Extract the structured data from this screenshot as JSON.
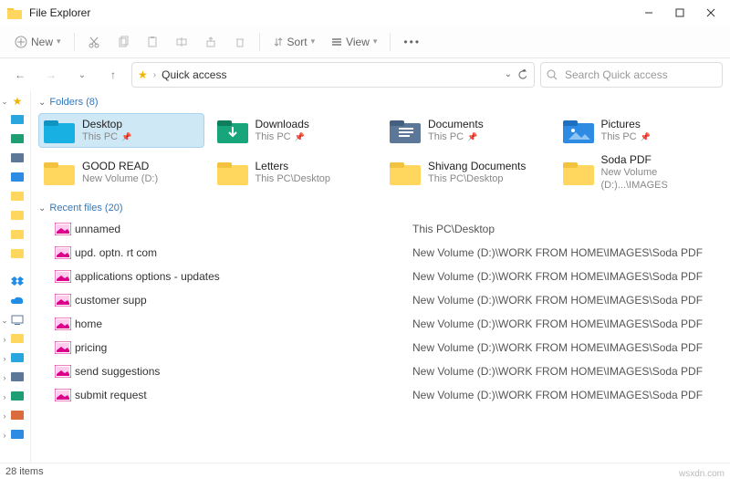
{
  "window": {
    "title": "File Explorer"
  },
  "toolbar": {
    "new": "New",
    "sort": "Sort",
    "view": "View"
  },
  "address": {
    "crumb": "Quick access"
  },
  "search": {
    "placeholder": "Search Quick access"
  },
  "groups": {
    "folders_label": "Folders (8)",
    "recent_label": "Recent files (20)"
  },
  "folders": [
    {
      "name": "Desktop",
      "sub": "This PC",
      "pinned": true,
      "icon": "desktop",
      "selected": true
    },
    {
      "name": "Downloads",
      "sub": "This PC",
      "pinned": true,
      "icon": "download",
      "selected": false
    },
    {
      "name": "Documents",
      "sub": "This PC",
      "pinned": true,
      "icon": "document",
      "selected": false
    },
    {
      "name": "Pictures",
      "sub": "This PC",
      "pinned": true,
      "icon": "picture",
      "selected": false
    },
    {
      "name": "GOOD READ",
      "sub": "New Volume (D:)",
      "pinned": false,
      "icon": "folder",
      "selected": false
    },
    {
      "name": "Letters",
      "sub": "This PC\\Desktop",
      "pinned": false,
      "icon": "folder",
      "selected": false
    },
    {
      "name": "Shivang Documents",
      "sub": "This PC\\Desktop",
      "pinned": false,
      "icon": "folder",
      "selected": false
    },
    {
      "name": "Soda PDF",
      "sub": "New Volume (D:)...\\IMAGES",
      "pinned": false,
      "icon": "folder",
      "selected": false
    }
  ],
  "files": [
    {
      "name": "unnamed",
      "path": "This PC\\Desktop"
    },
    {
      "name": "upd. optn. rt com",
      "path": "New Volume (D:)\\WORK FROM HOME\\IMAGES\\Soda PDF"
    },
    {
      "name": "applications options - updates",
      "path": "New Volume (D:)\\WORK FROM HOME\\IMAGES\\Soda PDF"
    },
    {
      "name": "customer supp",
      "path": "New Volume (D:)\\WORK FROM HOME\\IMAGES\\Soda PDF"
    },
    {
      "name": "home",
      "path": "New Volume (D:)\\WORK FROM HOME\\IMAGES\\Soda PDF"
    },
    {
      "name": "pricing",
      "path": "New Volume (D:)\\WORK FROM HOME\\IMAGES\\Soda PDF"
    },
    {
      "name": "send suggestions",
      "path": "New Volume (D:)\\WORK FROM HOME\\IMAGES\\Soda PDF"
    },
    {
      "name": "submit request",
      "path": "New Volume (D:)\\WORK FROM HOME\\IMAGES\\Soda PDF"
    }
  ],
  "status": {
    "items": "28 items"
  },
  "brand": "wsxdn.com"
}
